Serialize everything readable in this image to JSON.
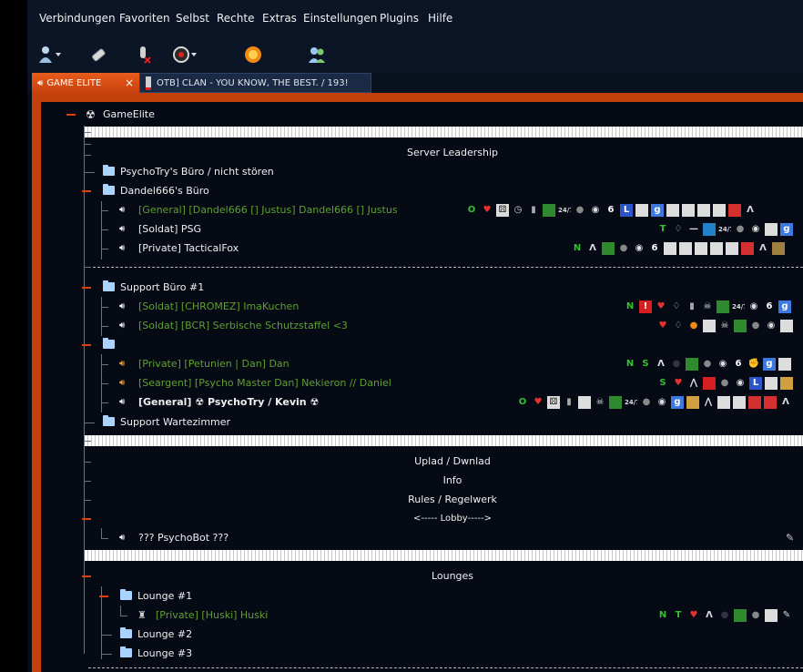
{
  "menu": [
    "Verbindungen",
    "Favoriten",
    "Selbst",
    "Rechte",
    "Extras",
    "Einstellungen",
    "Plugins",
    "Hilfe"
  ],
  "toolbar": {
    "icons": [
      "connect-icon",
      "disconnect-icon",
      "mute-mic-icon",
      "away-icon",
      "emoticon-icon",
      "contacts-icon"
    ]
  },
  "tabs": {
    "active": {
      "label": "GAME ELITE",
      "close": "×"
    },
    "inactive": {
      "label": "OTB] CLAN - YOU KNOW, THE BEST. / 193!"
    }
  },
  "server": {
    "name": "GameElite"
  },
  "tree": {
    "leadership_title": "Server Leadership",
    "channel1": "PsychoTry's Büro / nicht stören",
    "channel2": "Dandel666's Büro",
    "clients2": [
      "[General] [Dandel666 [] Justus] Dandel666 [] Justus",
      "[Soldat] PSG",
      "[Private] TacticalFox"
    ],
    "channel3": "Support Büro #1",
    "clients3": [
      "[Soldat] [CHROMEZ] ImaKuchen",
      "[Soldat] [BCR] Serbische Schutzstaffel <3"
    ],
    "clients4": [
      "[Private] [Petunien | Dan] Dan",
      "[Seargent] [Psycho Master Dan] Nekieron // Daniel",
      "[General] ☢ PsychoTry / Kevin ☢"
    ],
    "channel5": "Support Wartezimmer",
    "info_lines": [
      "Uplad / Dwnlad",
      "Info",
      "Rules / Regelwerk",
      "<----- Lobby----->"
    ],
    "bot_client": "??? PsychoBot ???",
    "lounges_title": "Lounges",
    "lounge1": "Lounge #1",
    "lounge1_client": "[Private] [Huski] Huski",
    "lounge2": "Lounge #2",
    "lounge3": "Lounge #3"
  },
  "badge_letters": {
    "N": "N",
    "T": "T",
    "S": "S",
    "O": "O",
    "six": "6",
    "g": "g"
  },
  "colors": {
    "accent": "#c3400d",
    "background": "#050a14",
    "green_text": "#5fa02f",
    "folder": "#a8d4ff"
  }
}
